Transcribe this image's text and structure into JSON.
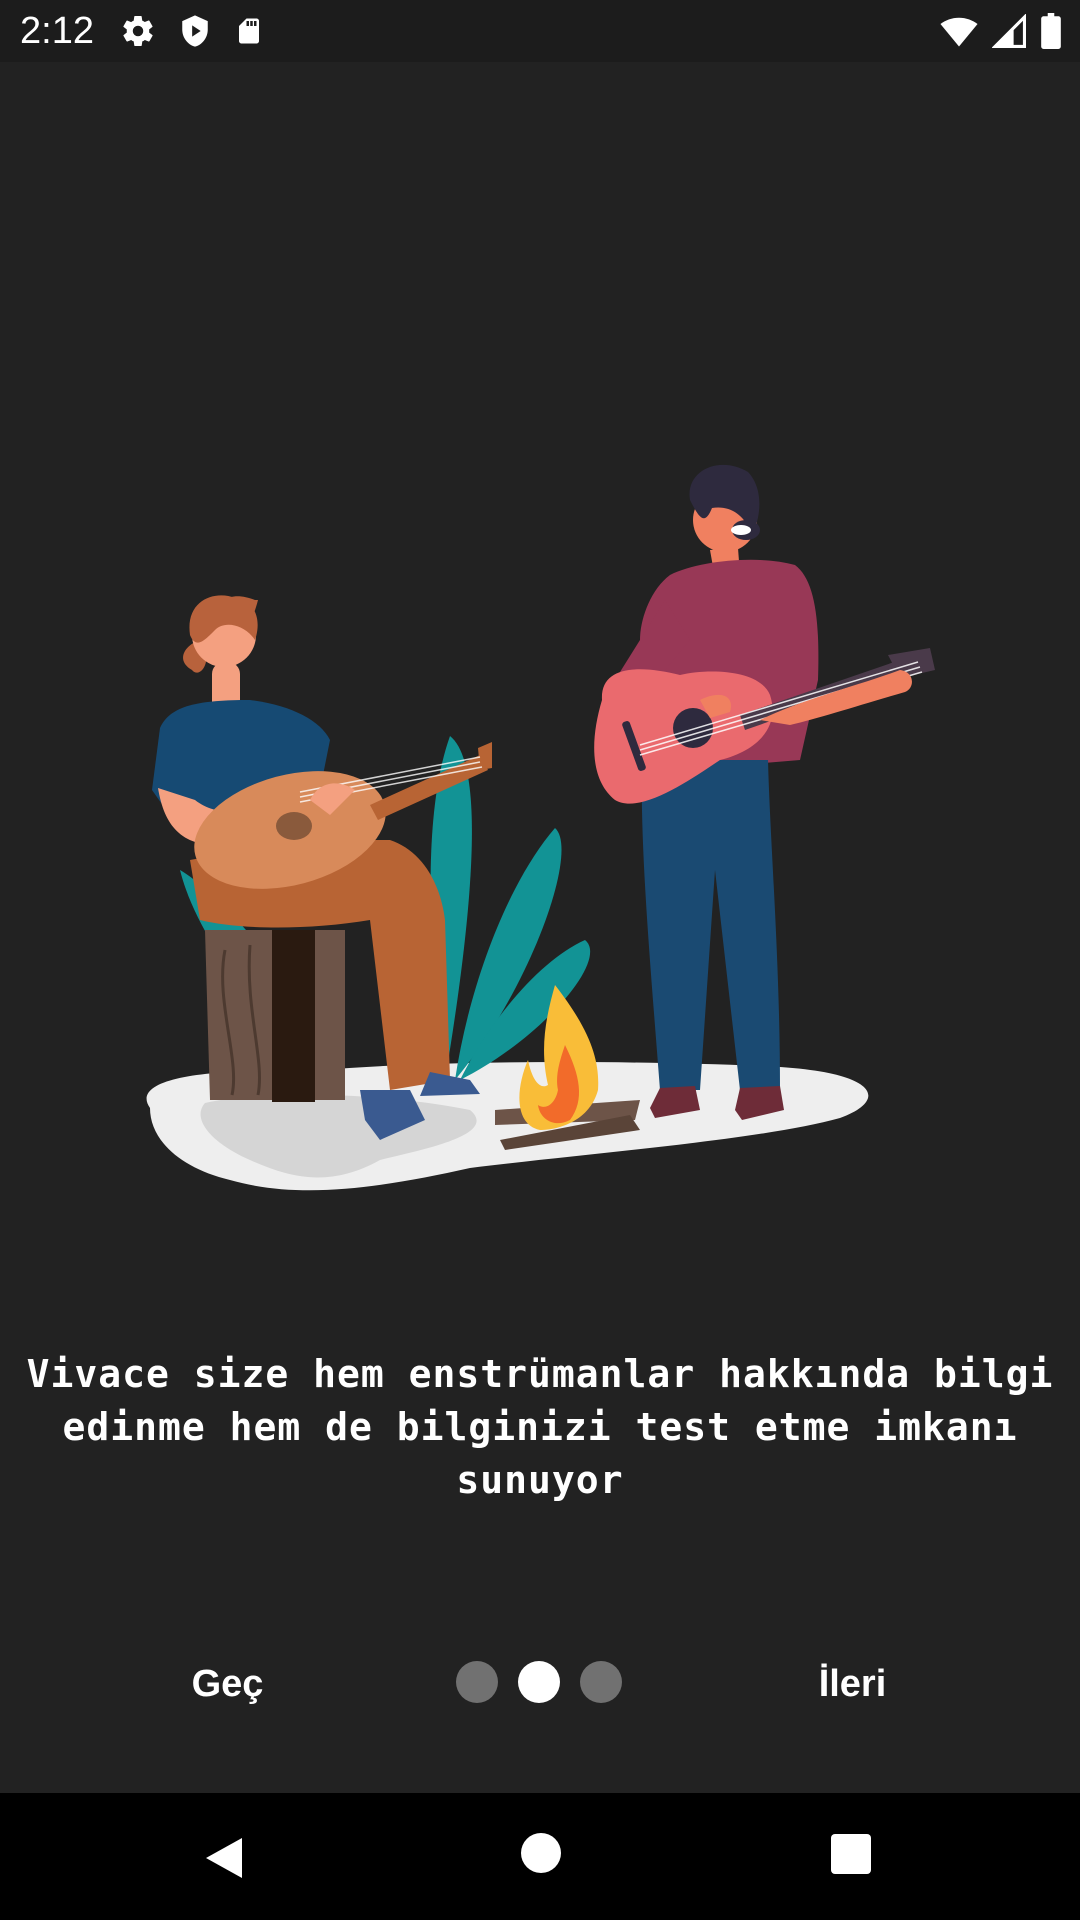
{
  "status_bar": {
    "time": "2:12",
    "left_icons": [
      "gear-icon",
      "shield-play-icon",
      "sd-card-icon"
    ],
    "right_icons": [
      "wifi-icon",
      "cell-signal-icon",
      "battery-icon"
    ]
  },
  "onboarding": {
    "illustration": "two-guitarists-campfire-illustration",
    "description": "Vivace size hem enstrümanlar hakkında bilgi edinme hem de bilginizi test etme imkanı sunuyor",
    "skip_label": "Geç",
    "next_label": "İleri",
    "page_indicator": {
      "pages": 3,
      "current": 2
    }
  },
  "colors": {
    "background": "#222222",
    "text": "#ffffff",
    "dot_inactive": "#717171",
    "dot_active": "#ffffff"
  },
  "nav_bar": {
    "icons": [
      "back-icon",
      "home-icon",
      "recents-icon"
    ]
  }
}
